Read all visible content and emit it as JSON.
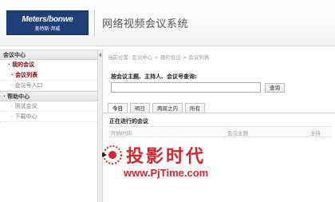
{
  "header": {
    "logo_line1": "Meters/bonwe",
    "logo_line2": "美特斯·邦威",
    "app_title": "网络视频会议系统"
  },
  "sidebar": {
    "group1": "会议中心",
    "sub1": "· 我的会议",
    "items1": [
      "· 会议列表",
      "· 会议号入口"
    ],
    "group2": "· 帮助中心",
    "items2": [
      "· 测试会议",
      "· 下载中心"
    ]
  },
  "main": {
    "breadcrumb": "当前位置: 会议中心 > 我的会议 > 会议列表",
    "search_label": "按会议主题、主持人、会议号查询:",
    "search_value": "",
    "search_button": "查询",
    "tabs": [
      "今日",
      "明日",
      "两周之内",
      "所有"
    ],
    "section_title": "正在进行的会议",
    "columns": [
      "开始时间",
      "会议主题",
      "主持"
    ]
  },
  "watermark": {
    "title": "投影时代",
    "url": "www.PjTime.com"
  },
  "colors": {
    "logo_bg": "#1f3f7a",
    "active_red": "#8a0000",
    "watermark_red": "#d9232a"
  }
}
